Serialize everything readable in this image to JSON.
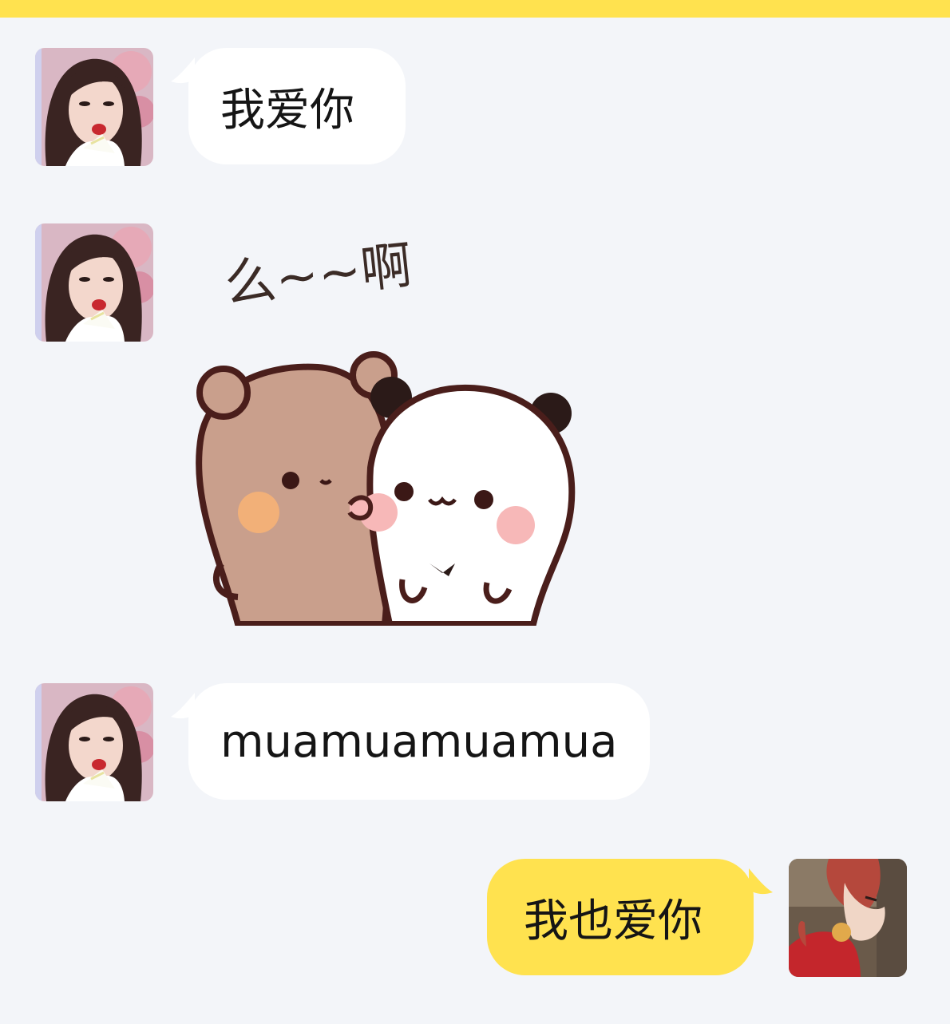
{
  "header": {
    "accent_color": "#ffe24f"
  },
  "messages": [
    {
      "sender": "contact",
      "type": "text",
      "text": "我爱你",
      "avatar_icon": "girl-with-flower-avatar"
    },
    {
      "sender": "contact",
      "type": "sticker",
      "sticker_text": "么~~啊",
      "sticker_icon": "bear-and-panda-kiss-sticker",
      "avatar_icon": "girl-with-flower-avatar"
    },
    {
      "sender": "contact",
      "type": "text",
      "text": "muamuamuamua",
      "avatar_icon": "girl-with-flower-avatar"
    },
    {
      "sender": "self",
      "type": "text",
      "text": "我也爱你",
      "avatar_icon": "anime-boy-avatar"
    }
  ],
  "colors": {
    "background": "#f3f5f9",
    "incoming_bubble": "#ffffff",
    "outgoing_bubble": "#ffe24f",
    "text": "#151515"
  }
}
